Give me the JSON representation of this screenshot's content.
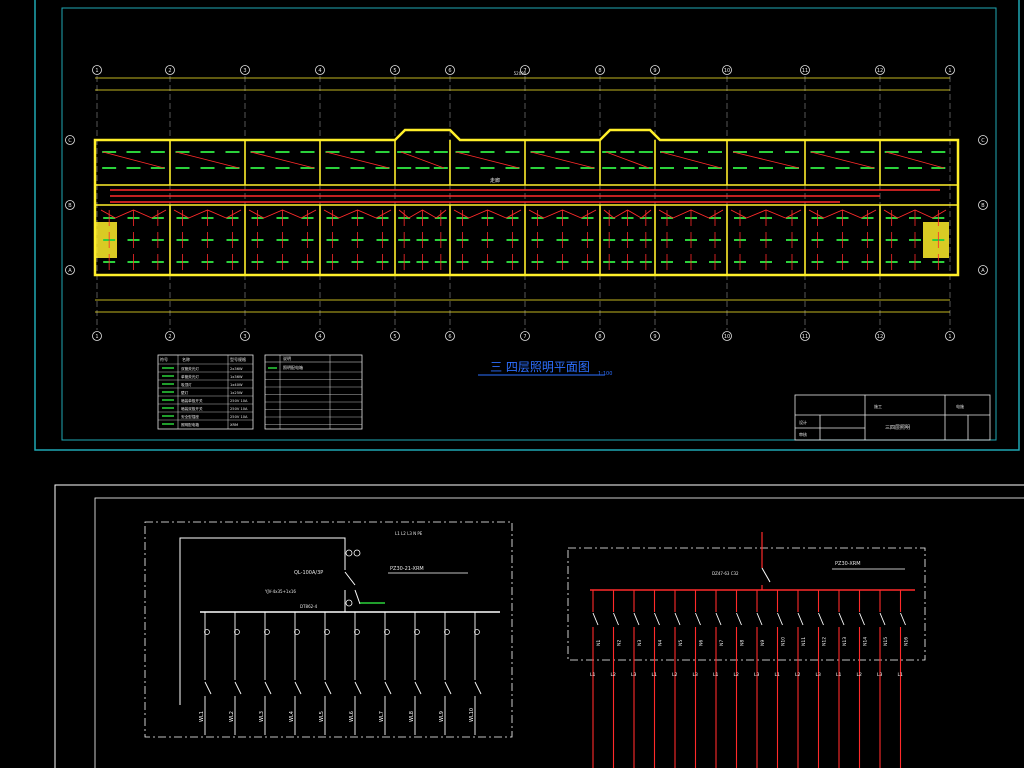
{
  "plan": {
    "title": "三 四层照明平面图",
    "scale_note": "1:100",
    "total_dim": "52000",
    "axis_labels": [
      "1",
      "2",
      "3",
      "4",
      "5",
      "6",
      "7",
      "8",
      "9",
      "10",
      "11",
      "12"
    ],
    "row_labels": [
      "C",
      "B",
      "A"
    ],
    "room_label": "走廊",
    "legend": {
      "header_symbol": "符号",
      "header_name": "名称",
      "header_model": "型号规格",
      "rows": [
        {
          "name": "双管荧光灯",
          "spec": "2x36W"
        },
        {
          "name": "单管荧光灯",
          "spec": "1x36W"
        },
        {
          "name": "吸顶灯",
          "spec": "1x40W"
        },
        {
          "name": "壁灯",
          "spec": "1x25W"
        },
        {
          "name": "暗装单极开关",
          "spec": "250V 10A"
        },
        {
          "name": "暗装双极开关",
          "spec": "250V 10A"
        },
        {
          "name": "安全型插座",
          "spec": "250V 10A"
        },
        {
          "name": "照明配电箱",
          "spec": "XRM"
        }
      ]
    },
    "notes_box": {
      "header": "说明",
      "line1": "照明配电箱"
    },
    "title_block": {
      "drawing_name": "三四层照明",
      "label_design": "设计",
      "label_check": "审核",
      "label_stage": "施工",
      "label_no": "电施"
    }
  },
  "schematic": {
    "main_breaker": "QL-100A/3P",
    "cable_main": "YJV-4x35+1x16",
    "meter": "DT862-4",
    "box_model": "PZ30-21-XRM",
    "bus_label": "L1 L2 L3 N PE",
    "branches": [
      "WL1",
      "WL2",
      "WL3",
      "WL4",
      "WL5",
      "WL6",
      "WL7",
      "WL8",
      "WL9",
      "WL10"
    ],
    "sub_box_model": "PZ30-XRM",
    "sub_breaker": "DZ47-63 C32",
    "sub_branches": [
      "N1",
      "N2",
      "N3",
      "N4",
      "N5",
      "N6",
      "N7",
      "N8",
      "N9",
      "N10",
      "N11",
      "N12",
      "N13",
      "N14",
      "N15",
      "N16"
    ],
    "phase_labels": [
      "L1",
      "L2",
      "L3",
      "L1",
      "L2",
      "L3",
      "L1",
      "L2",
      "L3",
      "L1",
      "L2",
      "L3",
      "L1",
      "L2",
      "L3",
      "L1"
    ]
  },
  "colors": {
    "frame": "#1fa7b4",
    "wall": "#ffef2a",
    "wire": "#ff2a2a",
    "fixture": "#2bd23b",
    "grid_line": "#e6e6e6",
    "grid_dash": "#d8d8d8"
  }
}
